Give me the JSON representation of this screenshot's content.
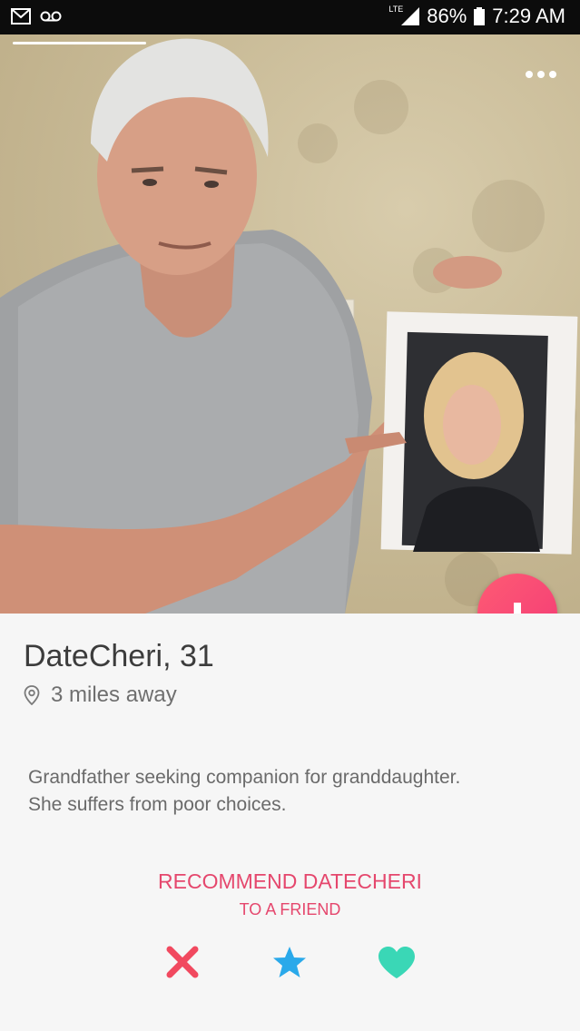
{
  "status_bar": {
    "network": "LTE",
    "battery": "86%",
    "time": "7:29 AM",
    "left_icons": [
      "gmail-icon",
      "voicemail-icon"
    ]
  },
  "profile": {
    "name": "DateCheri",
    "age": "31",
    "distance": "3 miles away",
    "bio_line1": "Grandfather seeking companion for granddaughter.",
    "bio_line2": "She suffers from poor choices."
  },
  "recommend": {
    "title": "RECOMMEND DATECHERI",
    "subtitle": "TO A FRIEND"
  },
  "colors": {
    "accent": "#e5476d",
    "nope": "#f1495f",
    "superlike": "#2aa9ea",
    "like": "#3ad7b6"
  }
}
